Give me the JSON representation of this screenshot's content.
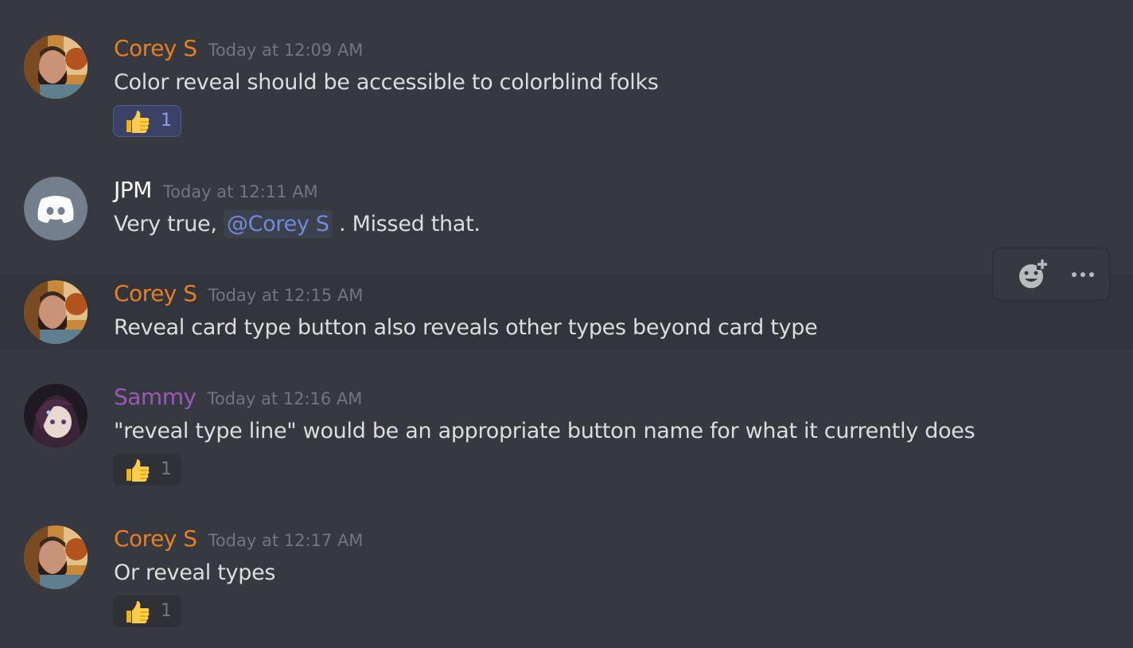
{
  "messages": [
    {
      "author": "Corey S",
      "author_color": "#e67e22",
      "timestamp": "Today at 12:09 AM",
      "text": "Color reveal should be accessible to colorblind folks",
      "reaction": {
        "emoji": "thumbs-up",
        "count": "1",
        "self_reacted": true
      }
    },
    {
      "author": "JPM",
      "author_color": "#ffffff",
      "timestamp": "Today at 12:11 AM",
      "text_before": "Very true, ",
      "mention": "@Corey S",
      "text_after": " . Missed that."
    },
    {
      "author": "Corey S",
      "author_color": "#e67e22",
      "timestamp": "Today at 12:15 AM",
      "text": "Reveal card type button also reveals other types beyond card type"
    },
    {
      "author": "Sammy",
      "author_color": "#9b59b6",
      "timestamp": "Today at 12:16 AM",
      "text": "\"reveal type line\" would be an appropriate button name for what it currently does",
      "reaction": {
        "emoji": "thumbs-up",
        "count": "1",
        "self_reacted": false
      }
    },
    {
      "author": "Corey S",
      "author_color": "#e67e22",
      "timestamp": "Today at 12:17 AM",
      "text": "Or reveal types",
      "reaction": {
        "emoji": "thumbs-up",
        "count": "1",
        "self_reacted": false
      }
    }
  ],
  "toolbar": {
    "add_reaction_icon": "add-reaction-icon",
    "more_icon": "more-options-icon"
  },
  "colors": {
    "background": "#36393f",
    "hover_background": "#32353b",
    "mention": "#7289da",
    "timestamp": "#72767d",
    "text": "#dcddde"
  }
}
